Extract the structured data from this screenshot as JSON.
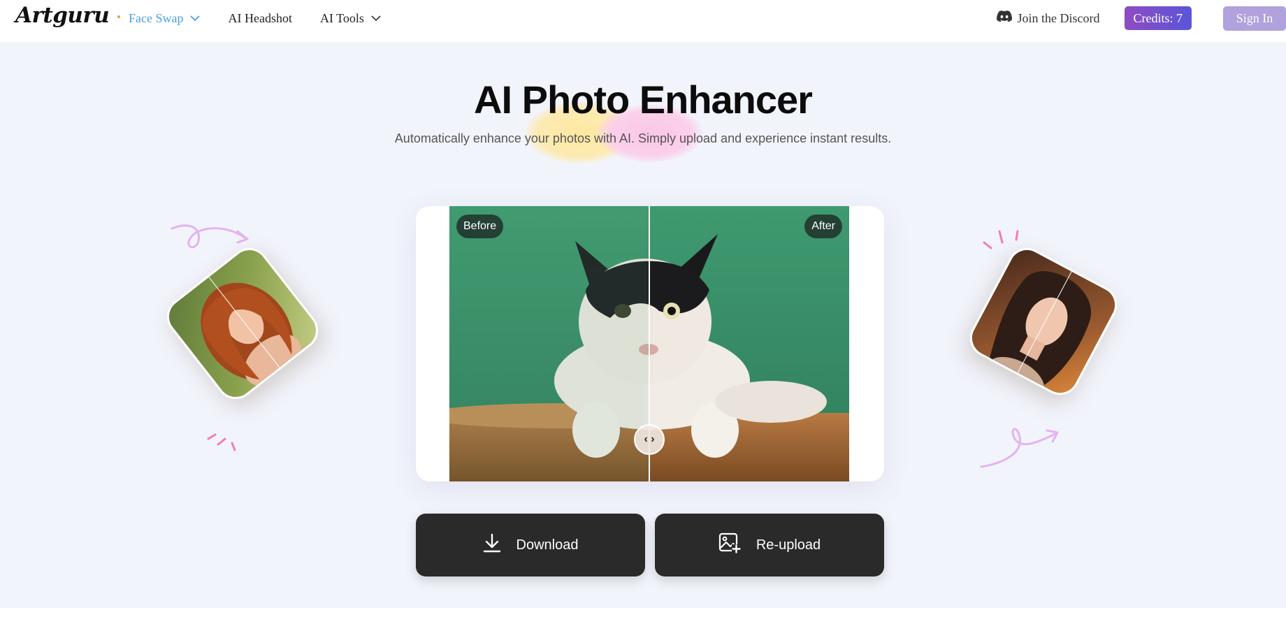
{
  "header": {
    "logo": "Artguru",
    "nav": [
      {
        "label": "Face Swap",
        "active": true,
        "dropdown": true
      },
      {
        "label": "AI Headshot",
        "active": false,
        "dropdown": false
      },
      {
        "label": "AI Tools",
        "active": false,
        "dropdown": true
      }
    ],
    "discord_label": "Join the Discord",
    "credits_label": "Credits: 7",
    "signin_label": "Sign In"
  },
  "hero": {
    "title": "AI Photo Enhancer",
    "subtitle": "Automatically enhance your photos with AI. Simply upload and experience instant results."
  },
  "compare": {
    "before_label": "Before",
    "after_label": "After",
    "handle_glyph": "‹ ›"
  },
  "actions": {
    "download_label": "Download",
    "reupload_label": "Re-upload"
  },
  "icons": {
    "face_swap_chevron": "chevron-down-icon",
    "ai_tools_chevron": "chevron-down-icon",
    "discord": "discord-icon",
    "download": "download-icon",
    "reupload": "image-plus-icon"
  },
  "colors": {
    "accent_blue": "#4a9fe6",
    "credits_gradient_start": "#8e4bc1",
    "credits_gradient_end": "#5a56d8",
    "signin_bg": "#b1a1dc",
    "button_dark": "#2a2a2a",
    "page_bg": "#f2f4fc"
  }
}
